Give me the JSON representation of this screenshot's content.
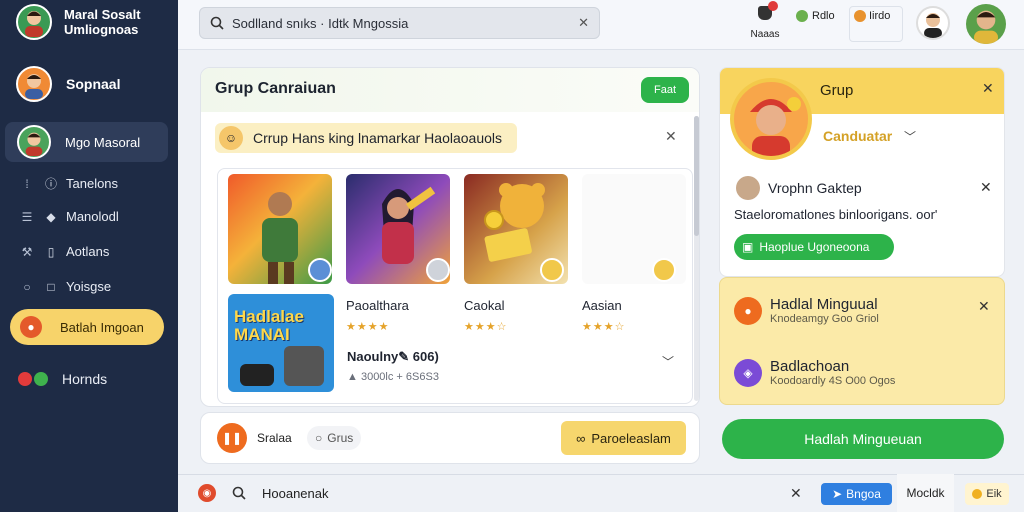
{
  "sidebar": {
    "brand": {
      "line1": "Maral Sosalt",
      "line2": "Umliognoas"
    },
    "profile_label": "Sopnaal",
    "active_item": "Mgo Masoral",
    "items": [
      {
        "label": "Tanelons",
        "icon": "bars-icon",
        "icon2": "info-icon"
      },
      {
        "label": "Manolodl",
        "icon": "list-icon",
        "icon2": "diamond-icon"
      },
      {
        "label": "Aotlans",
        "icon": "wrench-icon",
        "icon2": "doc-icon"
      },
      {
        "label": "Yoisgse",
        "icon": "circle-icon",
        "icon2": "square-icon"
      }
    ],
    "highlight_item": "Batlah Imgoan",
    "footer_item": "Hornds"
  },
  "topbar": {
    "search_text": "Sodlland snıks  ·  Idtk Mngossia",
    "notif_label": "Naaas",
    "coin_label": "Rdlo",
    "wallet_label": "Iirdo"
  },
  "main": {
    "title": "Grup Canraiuan",
    "pill_label": "Faat",
    "banner_text": "Crrup Hans king  lnamarkar Haolaoauols",
    "games": [
      {
        "name": "Paoalthara",
        "rating": 4
      },
      {
        "name": "Caokal",
        "rating": 3
      },
      {
        "name": "Aasian",
        "rating": 3
      }
    ],
    "promo_tile_text": "Hadlalae MANAI",
    "price_text": "Naoulny✎  606)",
    "price_sub": "3000lc + 6S6S3",
    "footer": {
      "label": "Sralaa",
      "radio_label": "Grus",
      "yellow_button": "Paroeleaslam"
    }
  },
  "right_panel": {
    "title": "Grup",
    "sub_label": "Canduatar",
    "user_name": "Vrophn Gaktep",
    "description": "Staeloromatlones binloorigans. oor'",
    "green_button": "Haoplue Ugoneoona",
    "rows": [
      {
        "title": "Hadlal Minguual",
        "sub": "Knodeamgy Goo Griol"
      },
      {
        "title": "Badlachoan",
        "sub": "Koodoardly 4S O00 Ogos"
      }
    ],
    "big_button": "Hadlah Mingueuan"
  },
  "bottombar": {
    "search_text": "Hooanenak",
    "blue_button": "Bngoa",
    "mock_label": "Mocldk",
    "yellow_label": "Eik"
  },
  "colors": {
    "sidebar_bg": "#1e2b45",
    "accent_green": "#2db34a",
    "accent_yellow": "#f8d45e",
    "accent_orange": "#ee6b1f"
  }
}
